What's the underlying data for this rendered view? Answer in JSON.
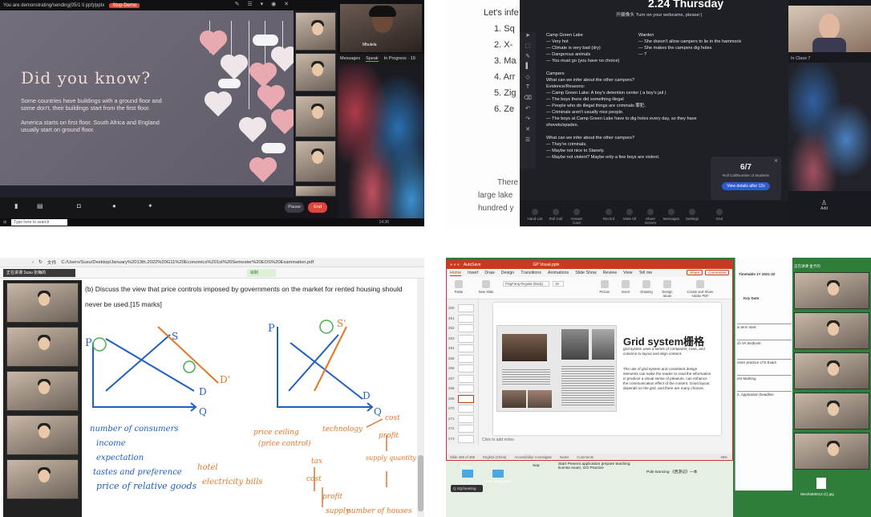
{
  "p1": {
    "sharing_notice": "You are demonstrating/sending(05/1 ti ppt)/pptx",
    "stop_label": "Stop Demo",
    "slide_title": "Did you know?",
    "para1": "Some countries have buildings with a ground floor and some don't, their buildings start from the first floor.",
    "para2": "America starts on first floor. South Africa and England usually start on ground floor.",
    "pause_label": "Pause",
    "end_label": "End",
    "chat_tabs": [
      "Messages",
      "Speak",
      "In Progress · 19"
    ],
    "taskbar_search": "Type here to search",
    "clock": "14:36",
    "participant_label": "Mbulela",
    "colors": {
      "heart": "#e8a9b0",
      "cloud": "#f4f4f6",
      "end": "#e0443a"
    }
  },
  "p2": {
    "doc_intro": "Let's infe",
    "list": [
      "1.  Sq",
      "2.  X-",
      "3.  Ma",
      "4.  Arr",
      "5.  Zig",
      "6.  Ze"
    ],
    "doc_tail": [
      "There",
      "large lake",
      "hundred y"
    ],
    "date_title": "2.24 Thursday",
    "subtitle": "开摄像头 Turn on your webcams, please:)",
    "left_lines": [
      "Camp Green Lake",
      "— Very hot",
      "— Climate is very bad (dry)",
      "— Dangerous animals",
      "— You must go (you have no choice)",
      "",
      "Campers",
      "What can we infer about the other campers?",
      "Evidence/Reasons:",
      "— Camp Green Lake: A boy's detention center ( a boy's jail )",
      "— The boys there did something illegal",
      "— People who do illegal things are criminals 罪犯.",
      "— Criminals aren't usually nice people.",
      "— The boys at Camp Green Lake have to dig holes every day, so they have shovels/spades.",
      "",
      "What can we infer about the other campers?",
      "— They're criminals.",
      "— Maybe not nice to Stanely.",
      "— Maybe not violent? Maybe only a few boys are violent."
    ],
    "right_lines": [
      "Warden",
      "— She doesn't allow campers to lie in the hammock",
      "— She makes the campers dig holes",
      "— ?"
    ],
    "rollcall_count": "6/7",
    "rollcall_label": "Roll Call/Number of Students",
    "rollcall_button": "View details after 12s",
    "in_class": "In Class 7",
    "add_label": "Add",
    "bottom_items": [
      "Hand List",
      "Roll Call",
      "Answer Card",
      "Record",
      "Mute All",
      "Share Screen",
      "Messages",
      "Settings",
      "End"
    ]
  },
  "p3": {
    "url": "C:/Users/Susu/Desktop/January%2013th,2022%20G11%20Economics%201st%20Semester%20EOS%20Examination.pdf",
    "file_tab": "文件",
    "meeting_label": "正在讲课 Susu 张梅的",
    "draw_label": "绘制",
    "question": "(b) Discuss the view that price controls imposed by governments on the market for rented housing should never be used.[15 marks]",
    "left_list": [
      "number of consumers",
      "income",
      "expectation",
      "tastes and preference",
      "price of relative goods"
    ],
    "extra_left": [
      "hotel",
      "electricity bills"
    ],
    "right_notes": [
      "price ceiling",
      "(price control)",
      "technology",
      "cost",
      "profit",
      "supply quantity",
      "tax",
      "cost",
      "profit",
      "supply",
      "number of houses"
    ],
    "chart_letters": {
      "p": "P",
      "s": "S",
      "d": "D",
      "q": "Q",
      "d2": "D'",
      "s2": "S'"
    }
  },
  "p4": {
    "title": "GP Visual.pptx",
    "autosave": "AutoSave",
    "tabs": [
      "Home",
      "Insert",
      "Draw",
      "Design",
      "Transitions",
      "Animations",
      "Slide Show",
      "Review",
      "View",
      "Tell me"
    ],
    "share": "Share",
    "comments": "Comments",
    "font_name": "PingFang Regular (Body)",
    "font_size": "18",
    "ribbon_buttons": [
      "Paste",
      "New Slide",
      "Picture",
      "Insert",
      "Drawing",
      "Design Ideas",
      "Create and Share Adobe PDF"
    ],
    "slide_title": "Grid system栅格",
    "text1": "grid system uses a series of containers, rows, and columns to layout and align content.",
    "text2": "The use of grid system and consistent design elements can make the reader to read the information in produce a visual sense of pleasure, can enhance the communication effect of the content. Good layout depends on the grid, and there are many choices.",
    "notes": "Click to add notes",
    "status": [
      "Slide 269 of 368",
      "English (China)",
      "Accessibility: Investigate",
      "Notes",
      "Comments",
      "46%"
    ],
    "thumbs": [
      "260",
      "261",
      "262",
      "263",
      "264",
      "265",
      "266",
      "267",
      "268",
      "269",
      "270",
      "271",
      "272",
      "273"
    ],
    "timetable_title": "Timetable 1Y 2021-22",
    "timetable_head": "Key Date",
    "timetable_rows": [
      "w term start.",
      "ch VA textbook",
      "nmer practice LTS Exam",
      "ent Marking",
      "2. Application Deadline"
    ],
    "lower_cells": [
      "Sep",
      "Start Present application prepare teaching license exam, GO Practice",
      "Pole Dancing 《西游记》一本"
    ],
    "folders": [
      "Travel",
      "Code application"
    ],
    "desktop_file": "Wechat05013 (1).jpg",
    "meeting_header": "正在讲课 金卡的",
    "chip": "Q SQ/meeting"
  }
}
